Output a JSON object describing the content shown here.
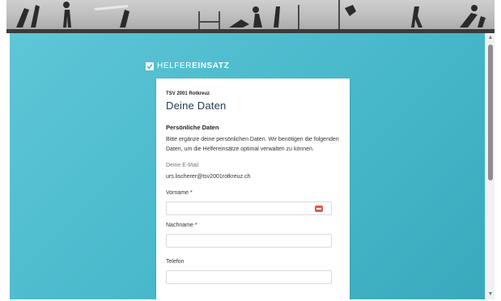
{
  "logo": {
    "light": "HELFER",
    "bold": "EINSATZ"
  },
  "form": {
    "club": "TSV 2001 Rotkreuz",
    "title": "Deine Daten",
    "section_title": "Persönliche Daten",
    "description": "Bitte ergänze deine persönlichen Daten. Wir benötigen die folgenden Daten, um die Helfereinsätze optimal verwalten zu können.",
    "email_label": "Deine E-Mail",
    "email_value": "urs.lischerer@tsv2001rotkreuz.ch",
    "fields": [
      {
        "label": "Vorname",
        "required_mark": "*",
        "value": ""
      },
      {
        "label": "Nachname",
        "required_mark": "*",
        "value": ""
      },
      {
        "label": "Telefon",
        "required_mark": "",
        "value": ""
      }
    ]
  },
  "scrollbar": {
    "up_arrow": "▲",
    "down_arrow": "▼"
  },
  "icons": {
    "logo": "checkmark-box-icon",
    "field_action": "password-manager-icon"
  },
  "colors": {
    "background_top": "#5ec6d7",
    "background_bottom": "#39aabd",
    "title": "#1f3b52",
    "field_icon": "#e0584f",
    "card": "#ffffff"
  }
}
